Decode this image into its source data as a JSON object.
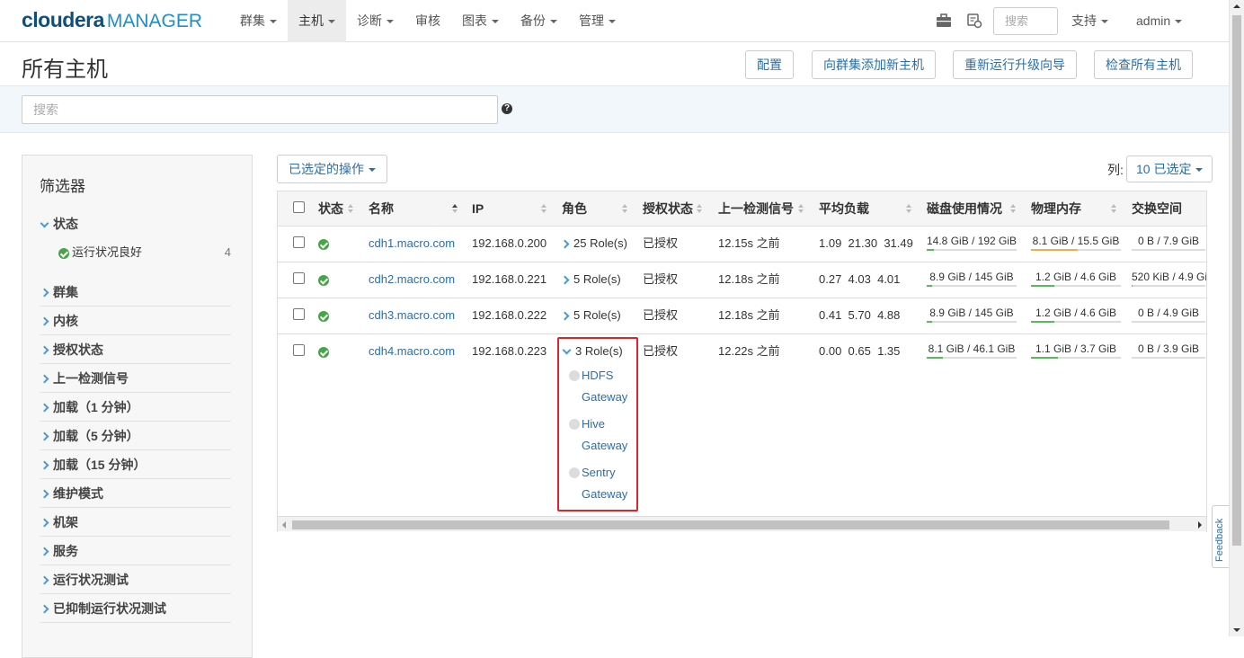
{
  "brand": {
    "part1": "cloudera",
    "part2": "MANAGER"
  },
  "nav": {
    "items": [
      {
        "label": "群集",
        "dropdown": true
      },
      {
        "label": "主机",
        "dropdown": true,
        "active": true
      },
      {
        "label": "诊断",
        "dropdown": true
      },
      {
        "label": "审核",
        "dropdown": false
      },
      {
        "label": "图表",
        "dropdown": true
      },
      {
        "label": "备份",
        "dropdown": true
      },
      {
        "label": "管理",
        "dropdown": true
      }
    ],
    "search_placeholder": "搜索",
    "support_label": "支持",
    "user_label": "admin"
  },
  "page": {
    "title": "所有主机",
    "buttons": {
      "configure": "配置",
      "add_hosts": "向群集添加新主机",
      "rerun_upgrade": "重新运行升级向导",
      "inspect_all": "检查所有主机"
    },
    "search_placeholder": "搜索",
    "help_glyph": "?"
  },
  "filters": {
    "title": "筛选器",
    "groups": [
      {
        "label": "状态",
        "expanded": true
      },
      {
        "label": "群集"
      },
      {
        "label": "内核"
      },
      {
        "label": "授权状态"
      },
      {
        "label": "上一检测信号"
      },
      {
        "label": "加载（1 分钟）"
      },
      {
        "label": "加载（5 分钟）"
      },
      {
        "label": "加载（15 分钟）"
      },
      {
        "label": "维护模式"
      },
      {
        "label": "机架"
      },
      {
        "label": "服务"
      },
      {
        "label": "运行状况测试"
      },
      {
        "label": "已抑制运行状况测试"
      }
    ],
    "status_option": {
      "label": "运行状况良好",
      "count": "4"
    }
  },
  "table": {
    "actions_label": "已选定的操作",
    "columns_label": "列:",
    "columns_selected": "10 已选定",
    "headers": {
      "status": "状态",
      "name": "名称",
      "ip": "IP",
      "roles": "角色",
      "license": "授权状态",
      "heartbeat": "上一检测信号",
      "load": "平均负载",
      "disk": "磁盘使用情况",
      "memory": "物理内存",
      "swap": "交换空间"
    },
    "rows": [
      {
        "name": "cdh1.macro.com",
        "ip": "192.168.0.200",
        "roles": "25 Role(s)",
        "license": "已授权",
        "heartbeat": "12.15s 之前",
        "load1": "1.09",
        "load5": "21.30",
        "load15": "31.49",
        "disk": "14.8 GiB / 192 GiB",
        "disk_pct": 8,
        "mem": "8.1 GiB / 15.5 GiB",
        "mem_pct": 52,
        "swap": "0 B / 7.9 GiB",
        "swap_pct": 0
      },
      {
        "name": "cdh2.macro.com",
        "ip": "192.168.0.221",
        "roles": "5 Role(s)",
        "license": "已授权",
        "heartbeat": "12.18s 之前",
        "load1": "0.27",
        "load5": "4.03",
        "load15": "4.01",
        "disk": "8.9 GiB / 145 GiB",
        "disk_pct": 6,
        "mem": "1.2 GiB / 4.6 GiB",
        "mem_pct": 26,
        "swap": "520 KiB / 4.9 GiB",
        "swap_pct": 1
      },
      {
        "name": "cdh3.macro.com",
        "ip": "192.168.0.222",
        "roles": "5 Role(s)",
        "license": "已授权",
        "heartbeat": "12.18s 之前",
        "load1": "0.41",
        "load5": "5.70",
        "load15": "4.88",
        "disk": "8.9 GiB / 145 GiB",
        "disk_pct": 6,
        "mem": "1.2 GiB / 4.6 GiB",
        "mem_pct": 26,
        "swap": "0 B / 4.9 GiB",
        "swap_pct": 0
      },
      {
        "name": "cdh4.macro.com",
        "ip": "192.168.0.223",
        "roles": "3 Role(s)",
        "license": "已授权",
        "heartbeat": "12.22s 之前",
        "load1": "0.00",
        "load5": "0.65",
        "load15": "1.35",
        "disk": "8.1 GiB / 46.1 GiB",
        "disk_pct": 18,
        "mem": "1.1 GiB / 3.7 GiB",
        "mem_pct": 30,
        "swap": "0 B / 3.9 GiB",
        "swap_pct": 0,
        "expanded_roles": [
          [
            "HDFS",
            "Gateway"
          ],
          [
            "Hive",
            "Gateway"
          ],
          [
            "Sentry",
            "Gateway"
          ]
        ]
      }
    ]
  },
  "feedback_label": "Feedback",
  "colors": {
    "accent": "#2d6fa3",
    "ok": "#47a447",
    "disk_bar": "#5cb85c",
    "mem_bar_high": "#f0ad4e",
    "highlight": "#d9272e"
  }
}
